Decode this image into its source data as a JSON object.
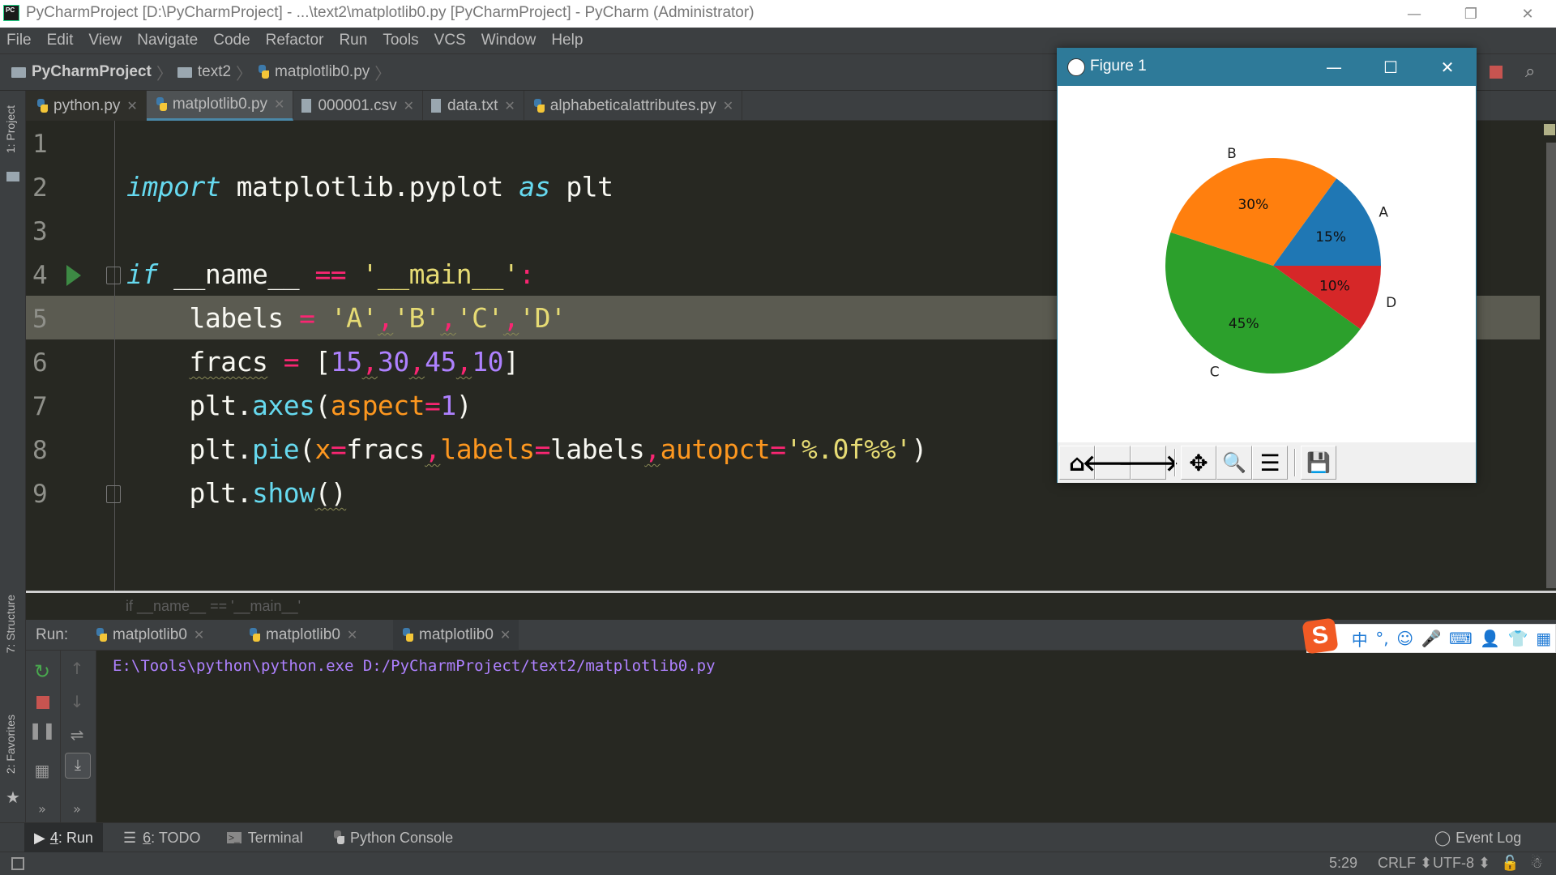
{
  "window": {
    "title": "PyCharmProject [D:\\PyCharmProject] - ...\\text2\\matplotlib0.py [PyCharmProject] - PyCharm (Administrator)",
    "controls": {
      "minimize": "—",
      "restore": "❐",
      "close": "✕"
    }
  },
  "menu": [
    "File",
    "Edit",
    "View",
    "Navigate",
    "Code",
    "Refactor",
    "Run",
    "Tools",
    "VCS",
    "Window",
    "Help"
  ],
  "breadcrumb": [
    "PyCharmProject",
    "text2",
    "matplotlib0.py"
  ],
  "tabs": [
    {
      "label": "python.py",
      "icon": "python-file-icon"
    },
    {
      "label": "matplotlib0.py",
      "icon": "python-file-icon",
      "active": true
    },
    {
      "label": "000001.csv",
      "icon": "text-file-icon"
    },
    {
      "label": "data.txt",
      "icon": "text-file-icon"
    },
    {
      "label": "alphabeticalattributes.py",
      "icon": "python-file-icon"
    }
  ],
  "side_tools": {
    "project": "1: Project",
    "structure": "7: Structure",
    "favorites": "2: Favorites"
  },
  "editor": {
    "line_numbers": [
      "1",
      "2",
      "3",
      "4",
      "5",
      "6",
      "7",
      "8",
      "9"
    ],
    "current_line": 5,
    "lines": {
      "l2": {
        "import": "import",
        "module": " matplotlib.pyplot ",
        "as": "as",
        "alias": " plt"
      },
      "l4": {
        "if": "if",
        "name": " __name__ ",
        "eq": "==",
        "sp": " ",
        "main": "'__main__'",
        "colon": ":"
      },
      "l5": {
        "indent": "    ",
        "var": "labels ",
        "eq": "=",
        "sp": " ",
        "a": "'A'",
        "c1": ",",
        "b": "'B'",
        "c2": ",",
        "c": "'C'",
        "c3": ",",
        "d": "'D'"
      },
      "l6": {
        "indent": "    ",
        "var": "fracs",
        "sp1": " ",
        "eq": "=",
        "sp2": " ",
        "lb": "[",
        "n1": "15",
        "c1": ",",
        "n2": "30",
        "c2": ",",
        "n3": "45",
        "c3": ",",
        "n4": "10",
        "rb": "]"
      },
      "l7": {
        "indent": "    ",
        "obj": "plt.",
        "fn": "axes",
        "lp": "(",
        "kw": "aspect",
        "eq": "=",
        "val": "1",
        "rp": ")"
      },
      "l8": {
        "indent": "    ",
        "obj": "plt.",
        "fn": "pie",
        "lp": "(",
        "k1": "x",
        "e1": "=",
        "v1": "fracs",
        "c1": ",",
        "k2": "labels",
        "e2": "=",
        "v2": "labels",
        "c2": ",",
        "k3": "autopct",
        "e3": "=",
        "v3": "'%.0f%%'",
        "rp": ")"
      },
      "l9": {
        "indent": "    ",
        "obj": "plt.",
        "fn": "show",
        "paren": "()"
      }
    },
    "breadcrumb_hint": "if __name__ == '__main__'"
  },
  "run_panel": {
    "label": "Run:",
    "tabs": [
      "matplotlib0",
      "matplotlib0",
      "matplotlib0"
    ],
    "active_tab": 2,
    "output": "E:\\Tools\\python\\python.exe D:/PyCharmProject/text2/matplotlib0.py"
  },
  "bottom_tabs": [
    {
      "num": "4",
      "label": ": Run",
      "active": true
    },
    {
      "num": "6",
      "label": ": TODO"
    },
    {
      "num": "",
      "label": "Terminal"
    },
    {
      "num": "",
      "label": "Python Console"
    }
  ],
  "event_log": "Event Log",
  "status": {
    "position": "5:29",
    "line_sep": "CRLF ⬍",
    "encoding": "UTF-8 ⬍"
  },
  "ime": {
    "logo": "S",
    "items": [
      "中",
      "°,",
      "☺",
      "🎤",
      "⌨",
      "👤",
      "👕",
      "▦"
    ]
  },
  "figure": {
    "title": "Figure 1",
    "toolbar": [
      "home-button",
      "back-button",
      "forward-button",
      "pan-button",
      "zoom-button",
      "configure-subplots-button",
      "save-button"
    ],
    "toolbar_glyphs": [
      "⌂",
      "🡐",
      "🡒",
      "✥",
      "🔍",
      "☰",
      "💾"
    ]
  },
  "colors": {
    "A": "#1f77b4",
    "B": "#ff7f0e",
    "C": "#2ca02c",
    "D": "#d62728"
  },
  "chart_data": {
    "type": "pie",
    "title": "",
    "labels": [
      "A",
      "B",
      "C",
      "D"
    ],
    "values": [
      15,
      30,
      45,
      10
    ],
    "autopct": [
      "15%",
      "30%",
      "45%",
      "10%"
    ],
    "colors": [
      "#1f77b4",
      "#ff7f0e",
      "#2ca02c",
      "#d62728"
    ],
    "start_angle": 0,
    "direction": "counterclockwise"
  }
}
